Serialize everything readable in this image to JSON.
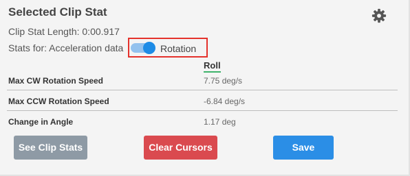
{
  "panel": {
    "title": "Selected Clip Stat",
    "settings_icon": "gear-icon",
    "clip_length": "Clip Stat Length: 0:00.917",
    "stats_for_label": "Stats for: Acceleration data",
    "toggle": {
      "state": "on",
      "label": "Rotation"
    },
    "highlight_color": "#e4312b"
  },
  "table": {
    "column_header": "Roll",
    "rows": [
      {
        "label": "Max CW Rotation Speed",
        "value": "7.75 deg/s"
      },
      {
        "label": "Max CCW Rotation Speed",
        "value": "-6.84 deg/s"
      },
      {
        "label": "Change in Angle",
        "value": "1.17 deg"
      }
    ]
  },
  "buttons": {
    "see_clip_stats": "See Clip Stats",
    "clear_cursors": "Clear Cursors",
    "save": "Save"
  },
  "colors": {
    "see_clip_stats": "#8e9aa5",
    "clear_cursors": "#da4a4f",
    "save": "#2b8ee6",
    "toggle_on": "#1e8ce6"
  }
}
